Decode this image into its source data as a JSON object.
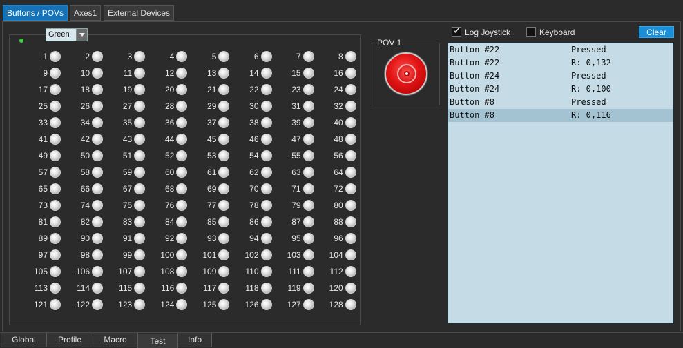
{
  "top_tabs": [
    {
      "label": "Buttons / POVs",
      "active": true
    },
    {
      "label": "Axes1",
      "active": false
    },
    {
      "label": "External Devices",
      "active": false
    }
  ],
  "buttons_panel": {
    "color_select_value": "Green",
    "buttons": [
      "1",
      "2",
      "3",
      "4",
      "5",
      "6",
      "7",
      "8",
      "9",
      "10",
      "11",
      "12",
      "13",
      "14",
      "15",
      "16",
      "17",
      "18",
      "19",
      "20",
      "21",
      "22",
      "23",
      "24",
      "25",
      "26",
      "27",
      "28",
      "29",
      "30",
      "31",
      "32",
      "33",
      "34",
      "35",
      "36",
      "37",
      "38",
      "39",
      "40",
      "41",
      "42",
      "43",
      "44",
      "45",
      "46",
      "47",
      "48",
      "49",
      "50",
      "51",
      "52",
      "53",
      "54",
      "55",
      "56",
      "57",
      "58",
      "59",
      "60",
      "61",
      "62",
      "63",
      "64",
      "65",
      "66",
      "67",
      "68",
      "69",
      "70",
      "71",
      "72",
      "73",
      "74",
      "75",
      "76",
      "77",
      "78",
      "79",
      "80",
      "81",
      "82",
      "83",
      "84",
      "85",
      "86",
      "87",
      "88",
      "89",
      "90",
      "91",
      "92",
      "93",
      "94",
      "95",
      "96",
      "97",
      "98",
      "99",
      "100",
      "101",
      "102",
      "103",
      "104",
      "105",
      "106",
      "107",
      "108",
      "109",
      "110",
      "111",
      "112",
      "113",
      "114",
      "115",
      "116",
      "117",
      "118",
      "119",
      "120",
      "121",
      "122",
      "123",
      "124",
      "125",
      "126",
      "127",
      "128"
    ]
  },
  "pov": {
    "title": "POV 1"
  },
  "options": {
    "log_joystick_label": "Log Joystick",
    "log_joystick_checked": true,
    "keyboard_label": "Keyboard",
    "keyboard_checked": false,
    "clear_label": "Clear"
  },
  "log": [
    {
      "button": "Button #22",
      "event": "Pressed",
      "selected": false
    },
    {
      "button": "Button #22",
      "event": "R: 0,132",
      "selected": false
    },
    {
      "button": "Button #24",
      "event": "Pressed",
      "selected": false
    },
    {
      "button": "Button #24",
      "event": "R: 0,100",
      "selected": false
    },
    {
      "button": "Button #8",
      "event": "Pressed",
      "selected": false
    },
    {
      "button": "Button #8",
      "event": "R: 0,116",
      "selected": true
    }
  ],
  "bottom_tabs": [
    {
      "label": "Global",
      "active": false
    },
    {
      "label": "Profile",
      "active": false
    },
    {
      "label": "Macro",
      "active": false
    },
    {
      "label": "Test",
      "active": true
    },
    {
      "label": "Info",
      "active": false
    }
  ]
}
